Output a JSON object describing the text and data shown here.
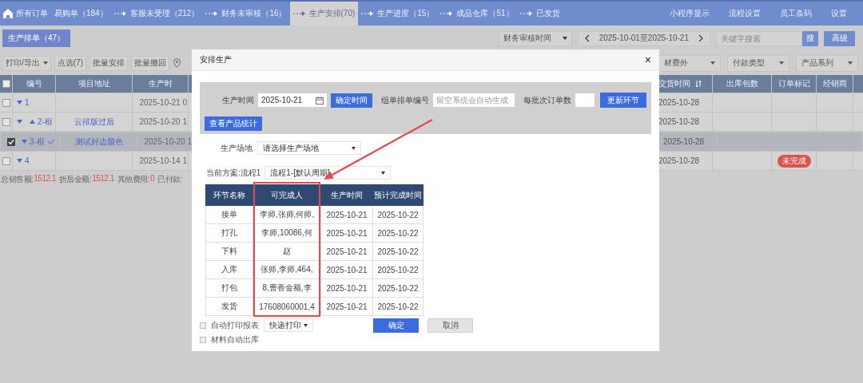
{
  "nav": {
    "tabs": [
      {
        "label": "所有订单",
        "selected": false,
        "home": true,
        "arrow": false
      },
      {
        "label": "易购单（184）",
        "selected": false,
        "home": false,
        "arrow": false
      },
      {
        "label": "客服未受理（212）",
        "selected": false,
        "home": false,
        "arrow": true
      },
      {
        "label": "财务未审核（16）",
        "selected": false,
        "home": false,
        "arrow": true
      },
      {
        "label": "生产安排(70)",
        "selected": true,
        "home": false,
        "arrow": true
      },
      {
        "label": "生产进度（15）",
        "selected": false,
        "home": false,
        "arrow": true
      },
      {
        "label": "成品仓库（51）",
        "selected": false,
        "home": false,
        "arrow": true
      },
      {
        "label": "已发货",
        "selected": false,
        "home": false,
        "arrow": true
      }
    ],
    "links": [
      "小程序显示",
      "流程设置",
      "员工条码",
      "设置"
    ]
  },
  "subtabs": [
    {
      "label": "生产排单（47）",
      "selected": true
    }
  ],
  "filters": {
    "time_field": "财务审核时间",
    "date_range": "2025-10-01至2025-10-21",
    "search": {
      "placeholder": "关键字搜索"
    },
    "search_button": "搜",
    "advanced_button": "高级"
  },
  "toolbar": {
    "left": [
      {
        "label": "打印/导出",
        "dropdown": true
      },
      {
        "label": "点选(7)",
        "dropdown": false
      },
      {
        "label": "批量安排",
        "dropdown": false
      },
      {
        "label": "批量撤回",
        "dropdown": false
      }
    ],
    "right": [
      {
        "label": "材费外"
      },
      {
        "label": "付款类型"
      },
      {
        "label": "产品系列"
      }
    ]
  },
  "table": {
    "all_checked": false,
    "columns_left": [
      {
        "label": "编号"
      },
      {
        "label": "项目地址"
      },
      {
        "label": "生产时"
      }
    ],
    "columns_right": [
      {
        "label": "交货时间",
        "sortable": true
      },
      {
        "label": "出库包数",
        "sortable": false
      },
      {
        "label": "订单标记",
        "sortable": false
      },
      {
        "label": "经销商",
        "sortable": false
      }
    ],
    "rows": [
      {
        "checked": false,
        "selected": false,
        "number": "1",
        "sub_caret": false,
        "done_mark": false,
        "production_time": "2025-10-21 0",
        "delivery_time": "2025-10-28"
      },
      {
        "checked": false,
        "selected": false,
        "number": "2-框",
        "sub_caret": true,
        "done_mark": false,
        "address": "云排版过后",
        "production_time": "2025-10-20 1",
        "delivery_time": "2025-10-28"
      },
      {
        "checked": true,
        "selected": true,
        "number": "3-框",
        "sub_caret": false,
        "done_mark": true,
        "address": "测试封边颜色",
        "production_time": "2025-10-20 1",
        "delivery_time": "2025-10-28"
      },
      {
        "checked": false,
        "selected": false,
        "number": "4",
        "sub_caret": false,
        "done_mark": false,
        "production_time": "2025-10-14 1",
        "delivery_time": "2025-10-28",
        "tag": {
          "text": "未完成",
          "color": "#d9534f"
        }
      }
    ]
  },
  "summary": [
    {
      "label": "总销售额:",
      "value": "1512.1"
    },
    {
      "label": "折后金额:",
      "value": "1512.1"
    },
    {
      "label": "其他费用:",
      "value": "0"
    },
    {
      "label": "已付款:"
    }
  ],
  "dialog": {
    "title": "安排生产",
    "close": "×",
    "production_time": {
      "label": "生产时间",
      "value": "2025-10-21"
    },
    "confirm_time_button": "确定时间",
    "batch_number": {
      "label": "组单排单编号",
      "placeholder": "留空系统会自动生成"
    },
    "orders_per_batch": {
      "label": "每批次订单数"
    },
    "update_button": "更新环节",
    "stats_button": "查看产品统计",
    "site": {
      "label": "生产场地",
      "value": "请选择生产场地"
    },
    "plan": {
      "label": "当前方案:流程1",
      "value": "流程1-[默认周期]"
    },
    "steps": {
      "columns": [
        "环节名称",
        "可完成人",
        "生产时间",
        "预计完成时间"
      ],
      "rows": [
        [
          "接单",
          "李师,张师,何师,",
          "2025-10-21",
          "2025-10-22"
        ],
        [
          "打孔",
          "李师,10086,何",
          "2025-10-21",
          "2025-10-22"
        ],
        [
          "下料",
          "赵",
          "2025-10-21",
          "2025-10-22"
        ],
        [
          "入库",
          "张师,李师,464,",
          "2025-10-21",
          "2025-10-22"
        ],
        [
          "打包",
          "8,曹香金额,李",
          "2025-10-21",
          "2025-10-22"
        ],
        [
          "发货",
          "17608060001,4",
          "2025-10-21",
          "2025-10-22"
        ]
      ]
    },
    "auto_print": {
      "label": "自动打印报表",
      "checked": false
    },
    "print_type": "快递打印",
    "auto_outbound": {
      "label": "材料自动出库",
      "checked": false
    },
    "ok_button": "确定",
    "cancel_button": "取消"
  }
}
